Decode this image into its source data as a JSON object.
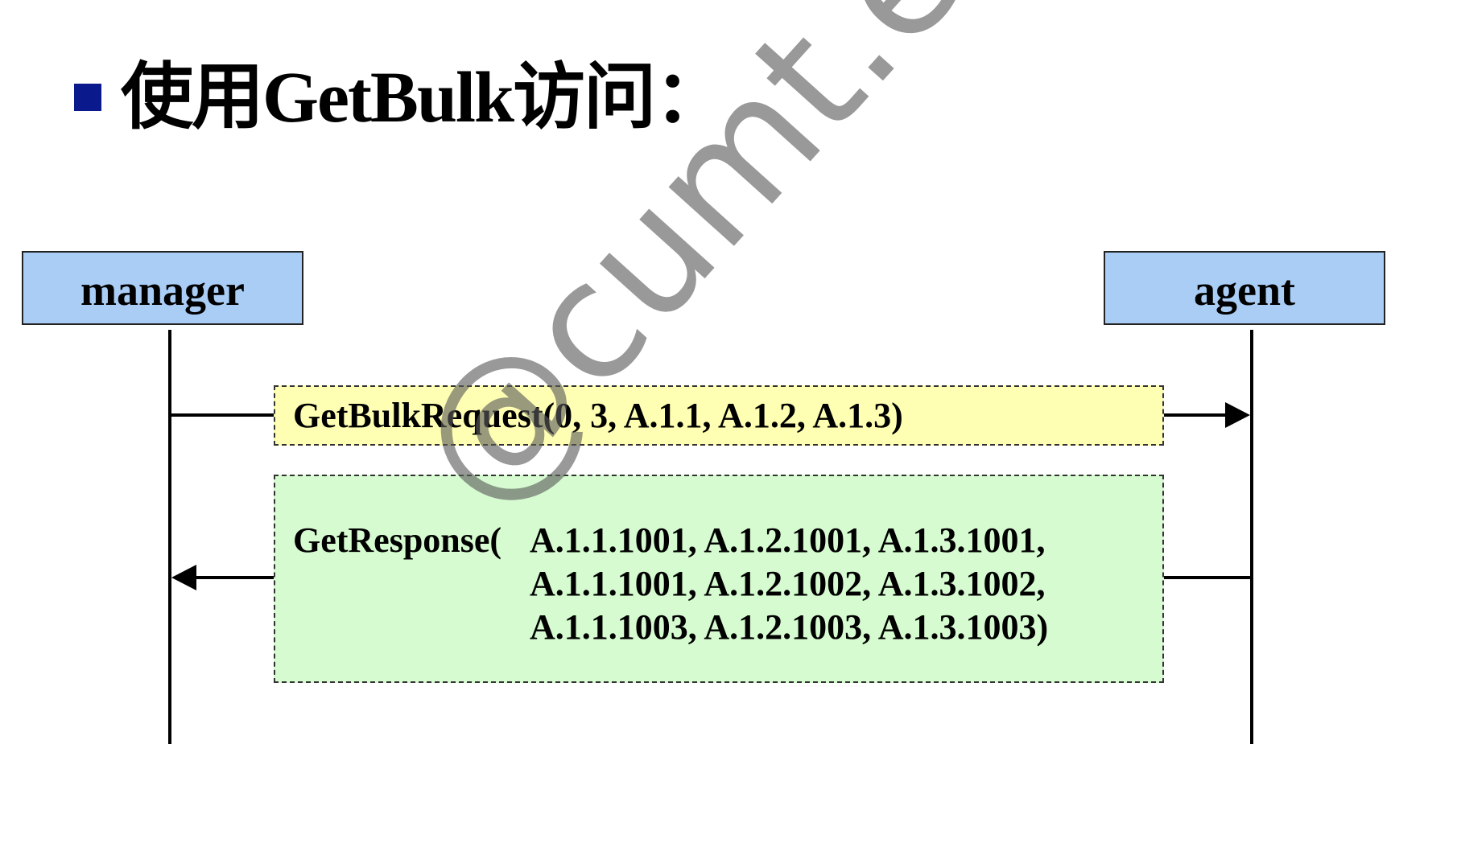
{
  "slide": {
    "title": "使用GetBulk访问："
  },
  "actors": {
    "manager": "manager",
    "agent": "agent"
  },
  "messages": {
    "request": "GetBulkRequest(0, 3, A.1.1, A.1.2, A.1.3)",
    "response": {
      "prefix": "GetResponse(",
      "lines": [
        "A.1.1.1001, A.1.2.1001, A.1.3.1001,",
        "A.1.1.1001, A.1.2.1002, A.1.3.1002,",
        "A.1.1.1003, A.1.2.1003, A.1.3.1003)"
      ]
    }
  },
  "watermark": "@cumt.edu.cn",
  "colors": {
    "bullet": "#0a1a8c",
    "actor_fill": "#a9cdf5",
    "request_fill": "#ffffb3",
    "response_fill": "#d6fbd0"
  }
}
